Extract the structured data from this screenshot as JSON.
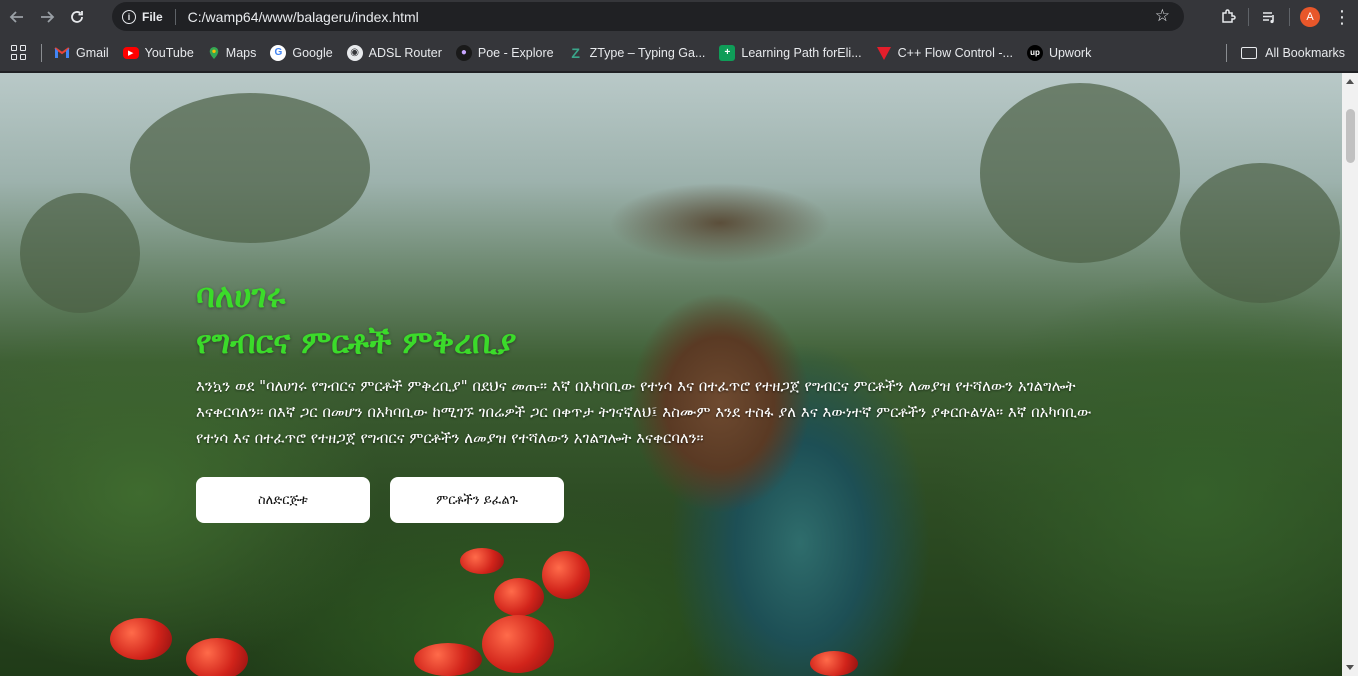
{
  "browser": {
    "url": "C:/wamp64/www/balageru/index.html",
    "file_chip": "File",
    "profile_initial": "A"
  },
  "icons": {
    "back": "arrow-left",
    "forward": "arrow-right",
    "reload": "reload",
    "info": "info-circle",
    "star": "star",
    "extensions": "puzzle-piece",
    "media": "media-queue",
    "menu": "kebab-menu"
  },
  "bookmarks": [
    {
      "label": "Gmail",
      "icon": "gmail-icon",
      "color": "#ea4335"
    },
    {
      "label": "YouTube",
      "icon": "youtube-icon",
      "color": "#ff0000"
    },
    {
      "label": "Maps",
      "icon": "maps-icon",
      "color": "#34a853"
    },
    {
      "label": "Google",
      "icon": "google-icon",
      "color": "#4285f4"
    },
    {
      "label": "ADSL Router",
      "icon": "globe-icon",
      "color": "#e8eaed"
    },
    {
      "label": "Poe - Explore",
      "icon": "poe-icon",
      "color": "#a06bf0"
    },
    {
      "label": "ZType – Typing Ga...",
      "icon": "ztype-icon",
      "color": "#3aa58a"
    },
    {
      "label": "Learning Path forEli...",
      "icon": "sheets-icon",
      "color": "#0f9d58"
    },
    {
      "label": "C++ Flow Control -...",
      "icon": "programiz-icon",
      "color": "#e41e2b"
    },
    {
      "label": "Upwork",
      "icon": "upwork-icon",
      "color": "#000000"
    }
  ],
  "all_bookmarks": "All Bookmarks",
  "hero": {
    "title": "ባለሀገሩ",
    "subtitle": "የግብርና ምርቶች ምቅረቢያ",
    "text": "እንኳን ወደ \"ባለሀገሩ የግብርና ምርቶች ምቅረቢያ\" በደህና መጡ። እኛ በአካባቢው የተነሳ እና በተፈጥሮ የተዘጋጀ የግብርና ምርቶችን ለመያዝ የተሻለውን አገልግሎት እናቀርባለን። በእኛ ጋር በመሆን በአካባቢው ከሚገኙ ገበሬዎች ጋር በቀጥታ ትገናኛለህ፤ እስሙም እንደ ተስፋ ያለ እና እውነተኛ ምርቶችን ያቀርቡልሃል። እኛ በአካባቢው የተነሳ እና በተፈጥሮ የተዘጋጀ የግብርና ምርቶችን ለመያዝ የተሻለውን አገልግሎት እናቀርባለን።",
    "button_primary": "ስለድርጅቱ",
    "button_secondary": "ምርቶችን ይፈልጉ"
  },
  "colors": {
    "accent_green": "#3bdb2a",
    "toolbar": "#35363a"
  }
}
